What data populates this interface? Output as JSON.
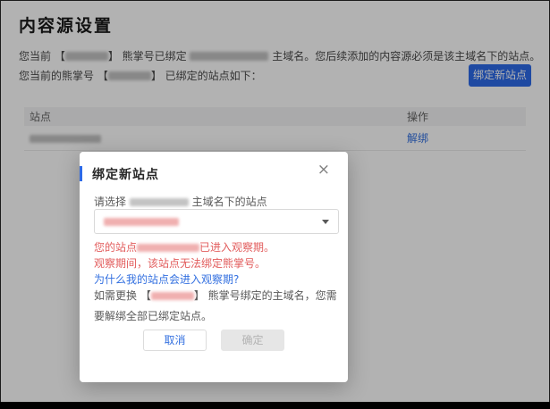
{
  "page": {
    "title": "内容源设置",
    "intro": {
      "line1_a": "您当前 【",
      "line1_b": "】 熊掌号已绑定 ",
      "line1_c": " 主域名。您后续添加的内容源必须是该主域名下的站点。",
      "line2_a": "您当前的熊掌号 【",
      "line2_b": "】 已绑定的站点如下："
    },
    "bind_button_label": "绑定新站点",
    "table": {
      "headers": [
        "站点",
        "操作"
      ],
      "rows": [
        {
          "site": "(站点名已打码)",
          "action_label": "解绑"
        }
      ]
    }
  },
  "modal": {
    "title": "绑定新站点",
    "close_glyph": "×",
    "select_label_a": "请选择 ",
    "select_label_b": " 主域名下的站点",
    "error_line1_a": "您的站点",
    "error_line1_b": "已进入观察期。",
    "error_line2": "观察期间，该站点无法绑定熊掌号。",
    "help_link": "为什么我的站点会进入观察期?",
    "note_a": "如需更换 【",
    "note_b": "】 熊掌号绑定的主域名，您需要解绑全部已绑定站点。",
    "cancel_label": "取消",
    "confirm_label": "确定"
  },
  "colors": {
    "primary_blue": "#2d6ae8",
    "link_blue": "#3370e0",
    "error_red": "#e25c5c",
    "overlay": "rgba(0,0,0,0.30)",
    "disabled_bg": "#e6e6e6"
  }
}
